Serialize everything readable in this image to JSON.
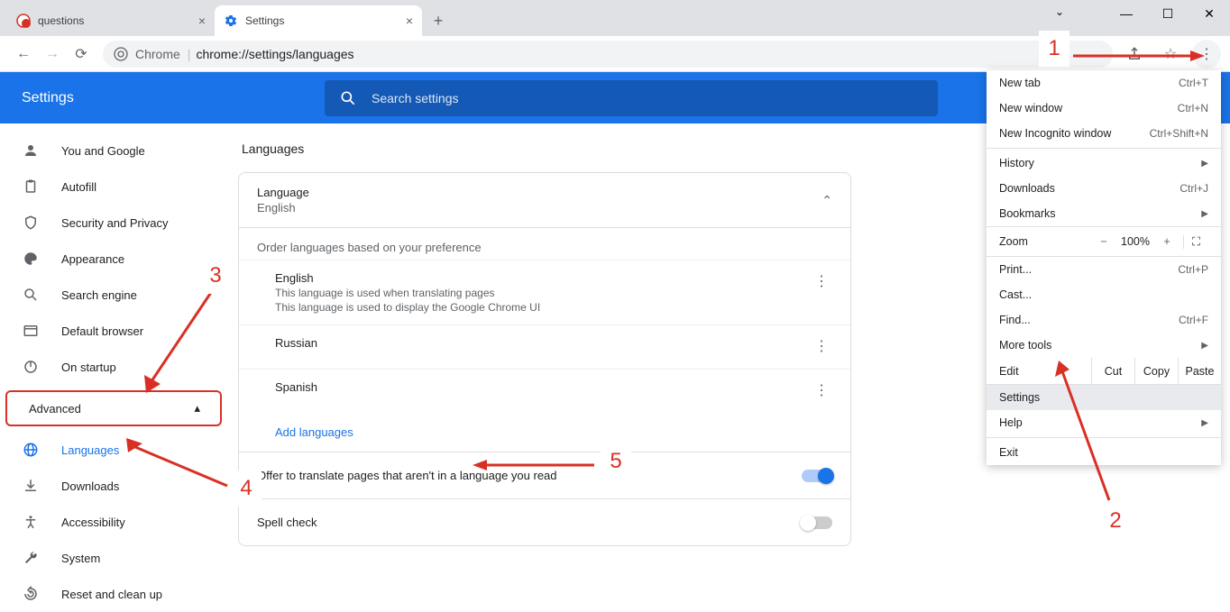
{
  "tabs": [
    {
      "title": "questions",
      "favicon": "globe"
    },
    {
      "title": "Settings",
      "favicon": "gear"
    }
  ],
  "omnibox": {
    "host": "Chrome",
    "url": "chrome://settings/languages"
  },
  "header": {
    "title": "Settings"
  },
  "search": {
    "placeholder": "Search settings"
  },
  "sidebar": {
    "items": [
      {
        "icon": "person",
        "label": "You and Google"
      },
      {
        "icon": "clipboard",
        "label": "Autofill"
      },
      {
        "icon": "shield",
        "label": "Security and Privacy"
      },
      {
        "icon": "palette",
        "label": "Appearance"
      },
      {
        "icon": "search",
        "label": "Search engine"
      },
      {
        "icon": "browser",
        "label": "Default browser"
      },
      {
        "icon": "power",
        "label": "On startup"
      }
    ],
    "advanced": "Advanced",
    "adv_items": [
      {
        "icon": "globe",
        "label": "Languages",
        "selected": true
      },
      {
        "icon": "download",
        "label": "Downloads"
      },
      {
        "icon": "access",
        "label": "Accessibility"
      },
      {
        "icon": "wrench",
        "label": "System"
      },
      {
        "icon": "reset",
        "label": "Reset and clean up"
      }
    ]
  },
  "main": {
    "title": "Languages",
    "language_card": {
      "title": "Language",
      "subtitle": "English",
      "order_text": "Order languages based on your preference",
      "languages": [
        {
          "name": "English",
          "sub1": "This language is used when translating pages",
          "sub2": "This language is used to display the Google Chrome UI"
        },
        {
          "name": "Russian"
        },
        {
          "name": "Spanish"
        }
      ],
      "add": "Add languages",
      "translate_row": "Offer to translate pages that aren't in a language you read",
      "spell_row": "Spell check"
    }
  },
  "ctxmenu": {
    "items1": [
      {
        "label": "New tab",
        "shortcut": "Ctrl+T"
      },
      {
        "label": "New window",
        "shortcut": "Ctrl+N"
      },
      {
        "label": "New Incognito window",
        "shortcut": "Ctrl+Shift+N"
      }
    ],
    "items2": [
      {
        "label": "History",
        "arrow": true
      },
      {
        "label": "Downloads",
        "shortcut": "Ctrl+J"
      },
      {
        "label": "Bookmarks",
        "arrow": true
      }
    ],
    "zoom": {
      "label": "Zoom",
      "value": "100%"
    },
    "items3": [
      {
        "label": "Print...",
        "shortcut": "Ctrl+P"
      },
      {
        "label": "Cast..."
      },
      {
        "label": "Find...",
        "shortcut": "Ctrl+F"
      },
      {
        "label": "More tools",
        "arrow": true
      }
    ],
    "edit": {
      "label": "Edit",
      "cut": "Cut",
      "copy": "Copy",
      "paste": "Paste"
    },
    "items4": [
      {
        "label": "Settings",
        "hl": true
      },
      {
        "label": "Help",
        "arrow": true
      }
    ],
    "items5": [
      {
        "label": "Exit"
      }
    ]
  },
  "annotations": {
    "n1": "1",
    "n2": "2",
    "n3": "3",
    "n4": "4",
    "n5": "5"
  }
}
